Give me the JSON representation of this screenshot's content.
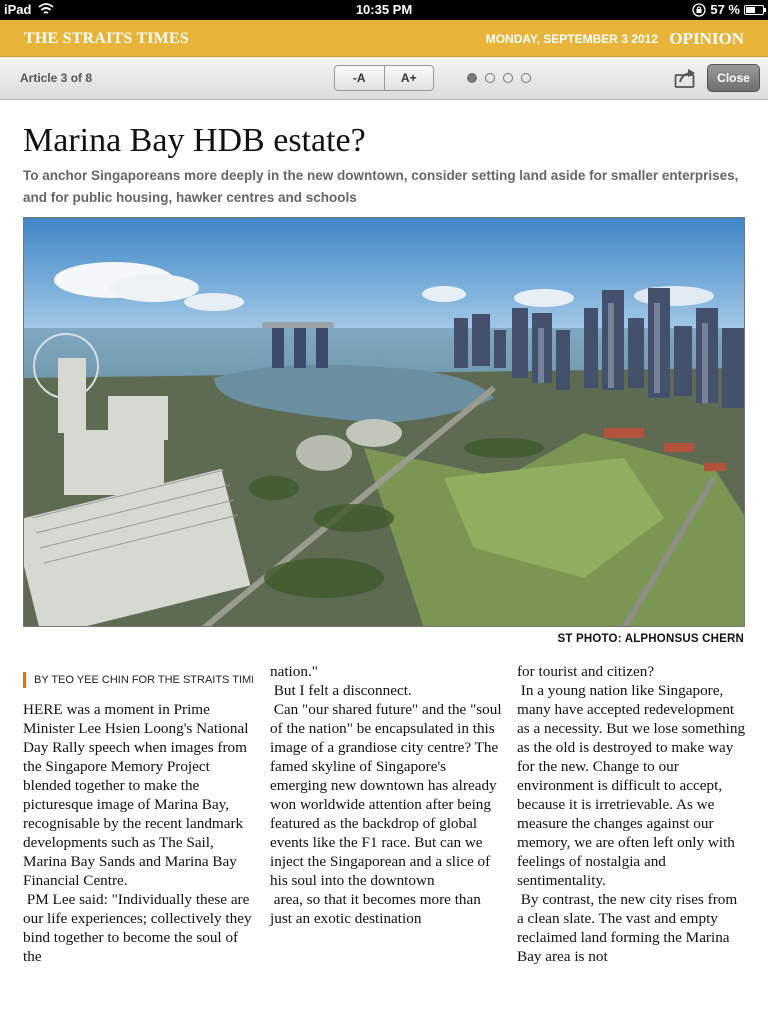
{
  "status_bar": {
    "device": "iPad",
    "time": "10:35 PM",
    "battery_percent": "57 %",
    "battery_level": 0.57,
    "icons": [
      "wifi-icon",
      "rotation-lock-icon",
      "battery-icon"
    ]
  },
  "masthead": {
    "brand": "THE STRAITS TIMES",
    "date": "MONDAY, SEPTEMBER 3 2012",
    "section": "OPINION",
    "accent_color": "#e8b43a"
  },
  "toolbar": {
    "article_count": "Article 3 of 8",
    "font_decrease": "-A",
    "font_increase": "A+",
    "page_dots": 4,
    "active_dot": 0,
    "close_label": "Close",
    "share_icon": "share-icon"
  },
  "article": {
    "headline": "Marina Bay HDB estate?",
    "standfirst": "To anchor Singaporeans more deeply in the new downtown, consider setting land aside for smaller enterprises, and for public housing, hawker centres and schools",
    "photo_credit": "ST PHOTO: ALPHONSUS CHERN",
    "byline": "BY TEO YEE CHIN FOR THE STRAITS TIMES T",
    "column1": [
      "HERE was a moment in Prime Minister Lee Hsien Loong's National Day Rally speech when images from the Singapore Memory Project blended together to make the picturesque image of Marina Bay, recognisable by the recent landmark developments such as The Sail, Marina Bay Sands and Marina Bay Financial Centre.",
      " PM Lee said: \"Individually these are our life experiences; collectively they bind together to become the soul of the"
    ],
    "column2": [
      "nation.\"",
      " But I felt a disconnect.",
      " Can \"our shared future\" and the \"soul of the nation\" be encapsulated in this image of a grandiose city centre? The famed skyline of Singapore's emerging new downtown has already won worldwide attention after being featured as the backdrop of global events like the F1 race. But can we inject the Singaporean and a slice of his soul into the downtown",
      " area, so that it becomes more than just an exotic destination"
    ],
    "column3": [
      "for tourist and citizen?",
      " In a young nation like Singapore, many have accepted redevelopment as a necessity. But we lose something as the old is destroyed to make way for the new. Change to our environment is difficult to accept, because it is irretrievable. As we measure the changes against our memory, we are often left only with feelings of nostalgia and sentimentality.",
      " By contrast, the new city rises from a clean slate. The vast and empty reclaimed land forming the Marina Bay area is not"
    ]
  }
}
